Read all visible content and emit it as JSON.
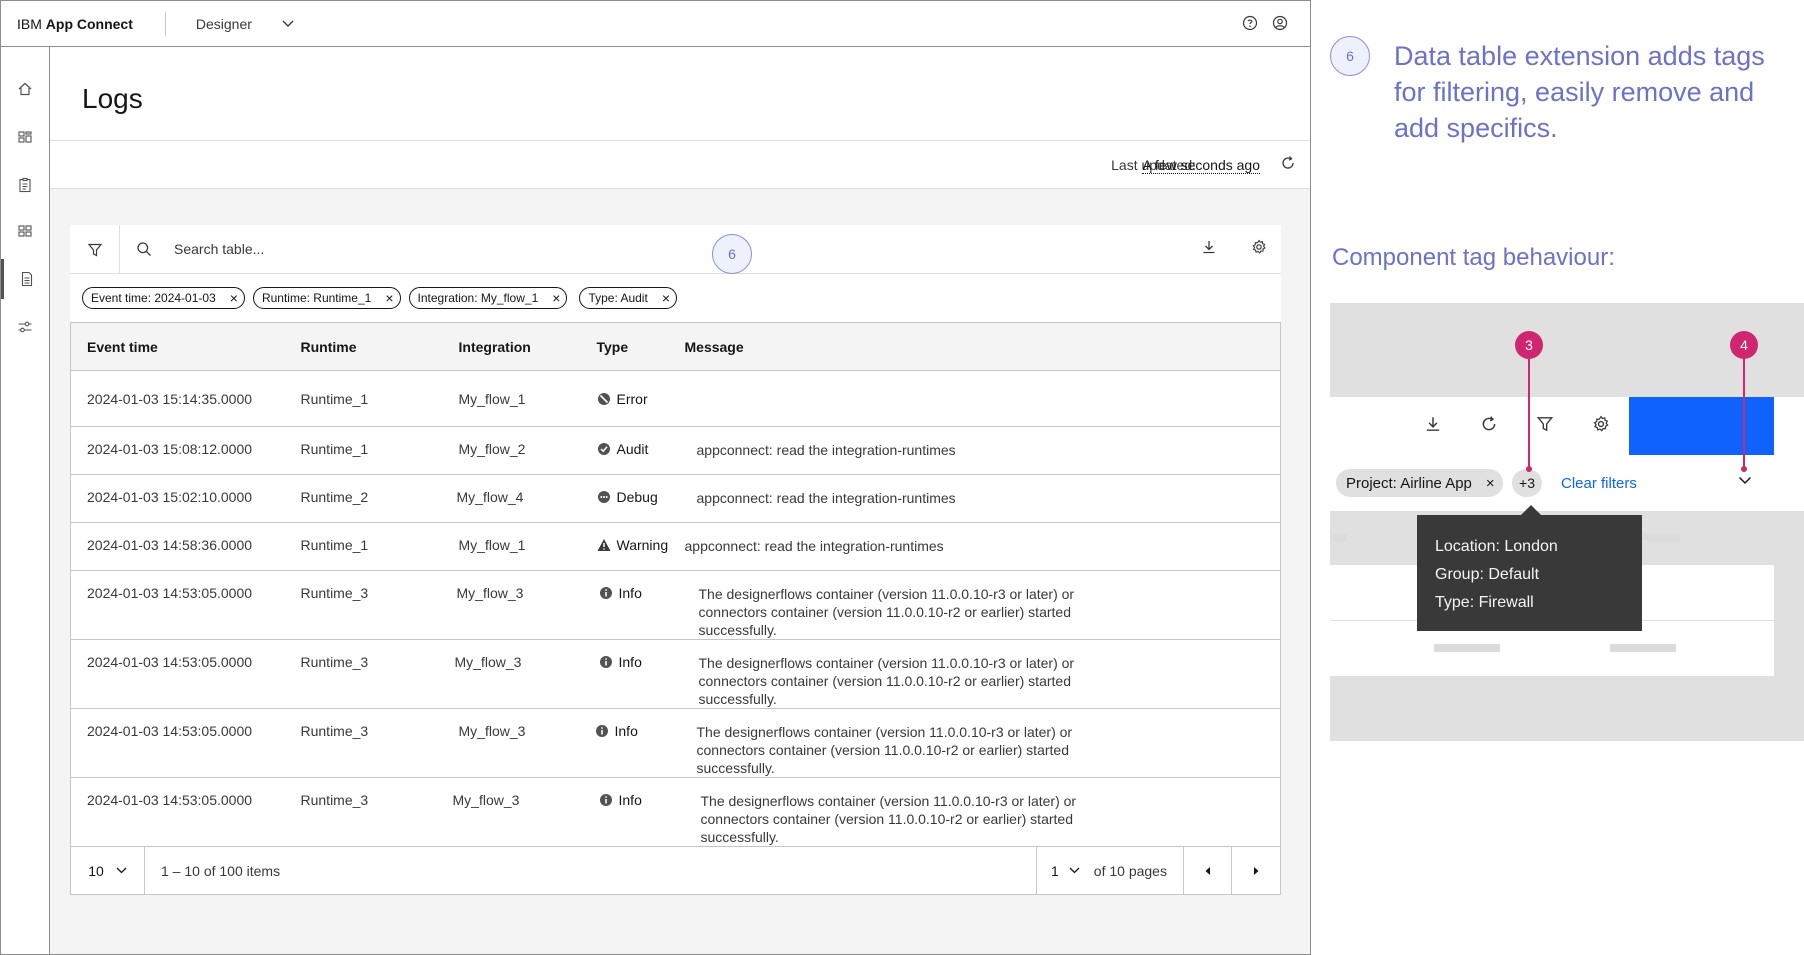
{
  "app": {
    "brand_prefix": "IBM ",
    "brand_name": "App Connect",
    "menu_label": "Designer",
    "icons": [
      "help-icon",
      "user-icon"
    ]
  },
  "sidenav": [
    "home-icon",
    "dashboard-icon",
    "catalog-icon",
    "flows-icon",
    "logs-icon",
    "settings-sliders-icon"
  ],
  "page": {
    "title": "Logs",
    "last_updated_label": "Last updated:",
    "last_updated_value": "A few seconds ago"
  },
  "table": {
    "search_placeholder": "Search table...",
    "callout": "6",
    "filter_tags": [
      "Event time: 2024-01-03",
      "Runtime: Runtime_1",
      "Integration: My_flow_1",
      "Type: Audit"
    ],
    "headers": [
      "Event time",
      "Runtime",
      "Integration",
      "Type",
      "Message"
    ],
    "rows": [
      {
        "time": "2024-01-03 15:14:35.0000",
        "runtime": "Runtime_1",
        "integration": "My_flow_1",
        "type": "Error",
        "icon": "error-icon",
        "message": ""
      },
      {
        "time": "2024-01-03 15:08:12.0000",
        "runtime": "Runtime_1",
        "integration": "My_flow_2",
        "type": "Audit",
        "icon": "audit-check-icon",
        "message": "appconnect: read the integration-runtimes"
      },
      {
        "time": "2024-01-03 15:02:10.0000",
        "runtime": "Runtime_2",
        "integration": "My_flow_4",
        "type": "Debug",
        "icon": "debug-icon",
        "message": "appconnect: read the integration-runtimes"
      },
      {
        "time": "2024-01-03 14:58:36.0000",
        "runtime": "Runtime_1",
        "integration": "My_flow_1",
        "type": "Warning",
        "icon": "warning-icon",
        "message": "appconnect: read the integration-runtimes"
      },
      {
        "time": "2024-01-03 14:53:05.0000",
        "runtime": "Runtime_3",
        "integration": "My_flow_3",
        "type": "Info",
        "icon": "info-icon",
        "message": "The designerflows container (version 11.0.0.10-r3 or later) or connectors container (version 11.0.0.10-r2 or earlier) started successfully."
      },
      {
        "time": "2024-01-03 14:53:05.0000",
        "runtime": "Runtime_3",
        "integration": "My_flow_3",
        "type": "Info",
        "icon": "info-icon",
        "message": "The designerflows container (version 11.0.0.10-r3 or later) or connectors container (version 11.0.0.10-r2 or earlier) started successfully."
      },
      {
        "time": "2024-01-03 14:53:05.0000",
        "runtime": "Runtime_3",
        "integration": "My_flow_3",
        "type": "Info",
        "icon": "info-icon",
        "message": "The designerflows container (version 11.0.0.10-r3 or later) or connectors container (version 11.0.0.10-r2 or earlier) started successfully."
      },
      {
        "time": "2024-01-03 14:53:05.0000",
        "runtime": "Runtime_3",
        "integration": "My_flow_3",
        "type": "Info",
        "icon": "info-icon",
        "message": "The designerflows container (version 11.0.0.10-r3 or later) or connectors container (version 11.0.0.10-r2 or earlier) started successfully."
      }
    ],
    "pagination": {
      "page_size": "10",
      "item_range": "1 – 10 of 100 items",
      "current_page": "1",
      "total_pages": "of 10 pages"
    }
  },
  "annotation": {
    "callout": "6",
    "text": "Data table extension adds tags for filtering, easily remove and add specifics.",
    "behaviour_title": "Component tag behaviour:",
    "demo": {
      "tag": "Project: Airline App",
      "overflow": "+3",
      "clear": "Clear filters",
      "pin_left": "3",
      "pin_right": "4",
      "tooltip": [
        "Location: London",
        "Group: Default",
        "Type: Firewall"
      ],
      "accent": "#0f62fe",
      "pin_color": "#d0266f"
    }
  }
}
